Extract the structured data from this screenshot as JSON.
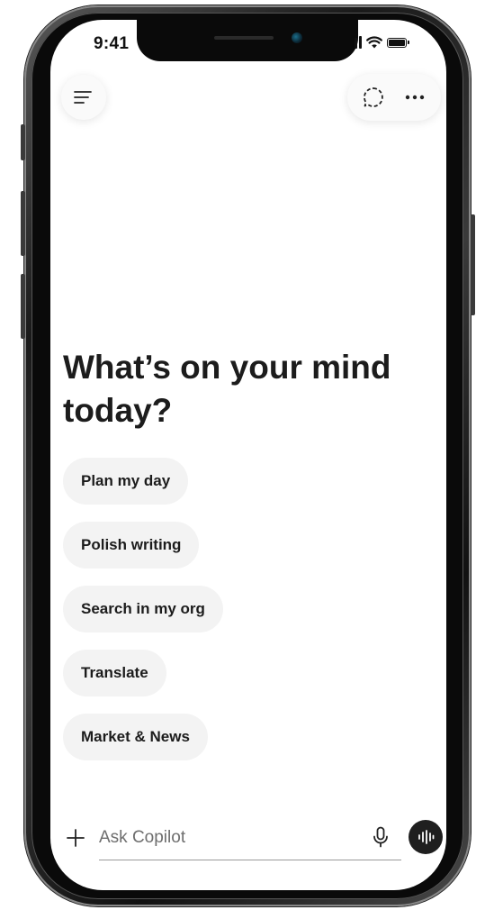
{
  "status_bar": {
    "time": "9:41"
  },
  "header": {
    "menu_icon": "hamburger-menu-icon",
    "new_chat_icon": "new-chat-icon",
    "more_icon": "more-options-icon"
  },
  "main": {
    "headline": "What’s on your mind today?",
    "suggestions": [
      {
        "label": "Plan my day"
      },
      {
        "label": "Polish writing"
      },
      {
        "label": "Search in my org"
      },
      {
        "label": "Translate"
      },
      {
        "label": "Market & News"
      }
    ]
  },
  "composer": {
    "placeholder": "Ask Copilot",
    "value": "",
    "plus_icon": "plus-icon",
    "mic_icon": "microphone-icon",
    "voice_icon": "voice-mode-icon"
  },
  "colors": {
    "text": "#1c1c1c",
    "chip_bg": "#f3f3f3",
    "voice_btn_bg": "#1f1f1f"
  }
}
